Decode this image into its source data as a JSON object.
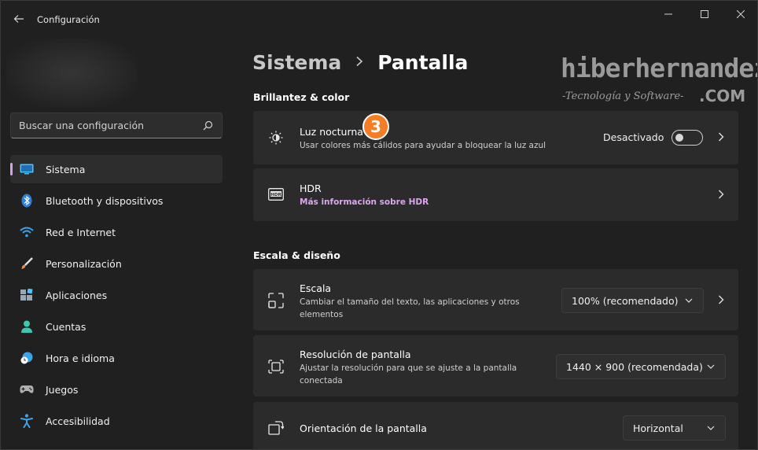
{
  "window": {
    "title": "Configuración",
    "accent": "#d6a3e6"
  },
  "sidebar": {
    "search_placeholder": "Buscar una configuración",
    "items": [
      {
        "label": "Sistema",
        "icon": "monitor-icon",
        "active": true
      },
      {
        "label": "Bluetooth y dispositivos",
        "icon": "bluetooth-icon"
      },
      {
        "label": "Red e Internet",
        "icon": "wifi-icon"
      },
      {
        "label": "Personalización",
        "icon": "brush-icon"
      },
      {
        "label": "Aplicaciones",
        "icon": "apps-icon"
      },
      {
        "label": "Cuentas",
        "icon": "person-icon"
      },
      {
        "label": "Hora e idioma",
        "icon": "globe-clock-icon"
      },
      {
        "label": "Juegos",
        "icon": "gamepad-icon"
      },
      {
        "label": "Accesibilidad",
        "icon": "accessibility-icon"
      }
    ]
  },
  "main": {
    "breadcrumb_parent": "Sistema",
    "breadcrumb_separator": ">",
    "breadcrumb_current": "Pantalla",
    "section_brightness": "Brillantez & color",
    "night_light": {
      "title": "Luz nocturna",
      "subtitle": "Usar colores más cálidos para ayudar a bloquear la luz azul",
      "state_label": "Desactivado",
      "enabled": false
    },
    "badge_number": "3",
    "hdr": {
      "title": "HDR",
      "link": "Más información sobre HDR"
    },
    "section_scale": "Escala & diseño",
    "scale": {
      "title": "Escala",
      "subtitle_line1": "Cambiar el tamaño del texto, las aplicaciones y otros",
      "subtitle_line2": "elementos",
      "value": "100% (recomendado)"
    },
    "resolution": {
      "title": "Resolución de pantalla",
      "subtitle_line1": "Ajustar la resolución para que se ajuste a la pantalla",
      "subtitle_line2": "conectada",
      "value": "1440 × 900 (recomendada)"
    },
    "orientation": {
      "title": "Orientación de la pantalla",
      "value": "Horizontal"
    }
  },
  "watermark": {
    "main": "hiberhernandez",
    "sub": "-Tecnología y Software-",
    "com": ".COM"
  }
}
